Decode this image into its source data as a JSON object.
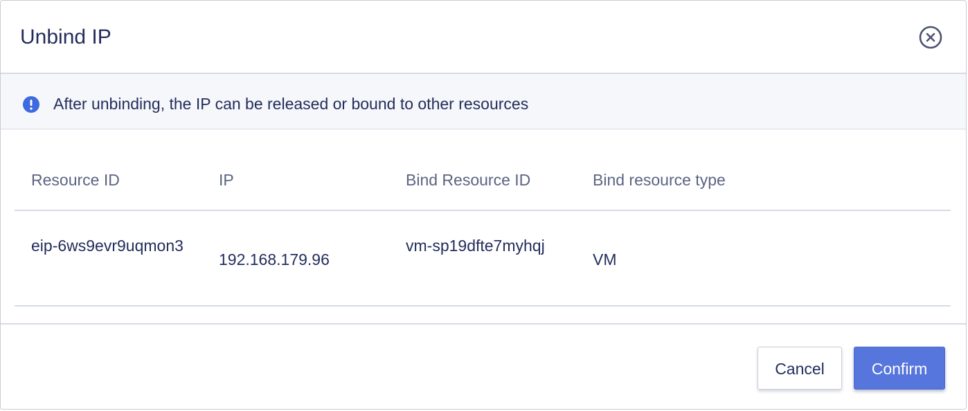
{
  "dialog": {
    "title": "Unbind IP",
    "close_icon": "close-circle-icon"
  },
  "alert": {
    "icon": "info-icon",
    "icon_color": "#3d6ae0",
    "text": "After unbinding, the IP can be released or bound to other resources"
  },
  "table": {
    "headers": [
      "Resource ID",
      "IP",
      "Bind Resource ID",
      "Bind resource type"
    ],
    "rows": [
      [
        "eip-6ws9evr9uqmon3",
        "192.168.179.96",
        "vm-sp19dfte7myhqj",
        "VM"
      ]
    ]
  },
  "footer": {
    "cancel_label": "Cancel",
    "confirm_label": "Confirm",
    "confirm_color": "#5675dd"
  }
}
